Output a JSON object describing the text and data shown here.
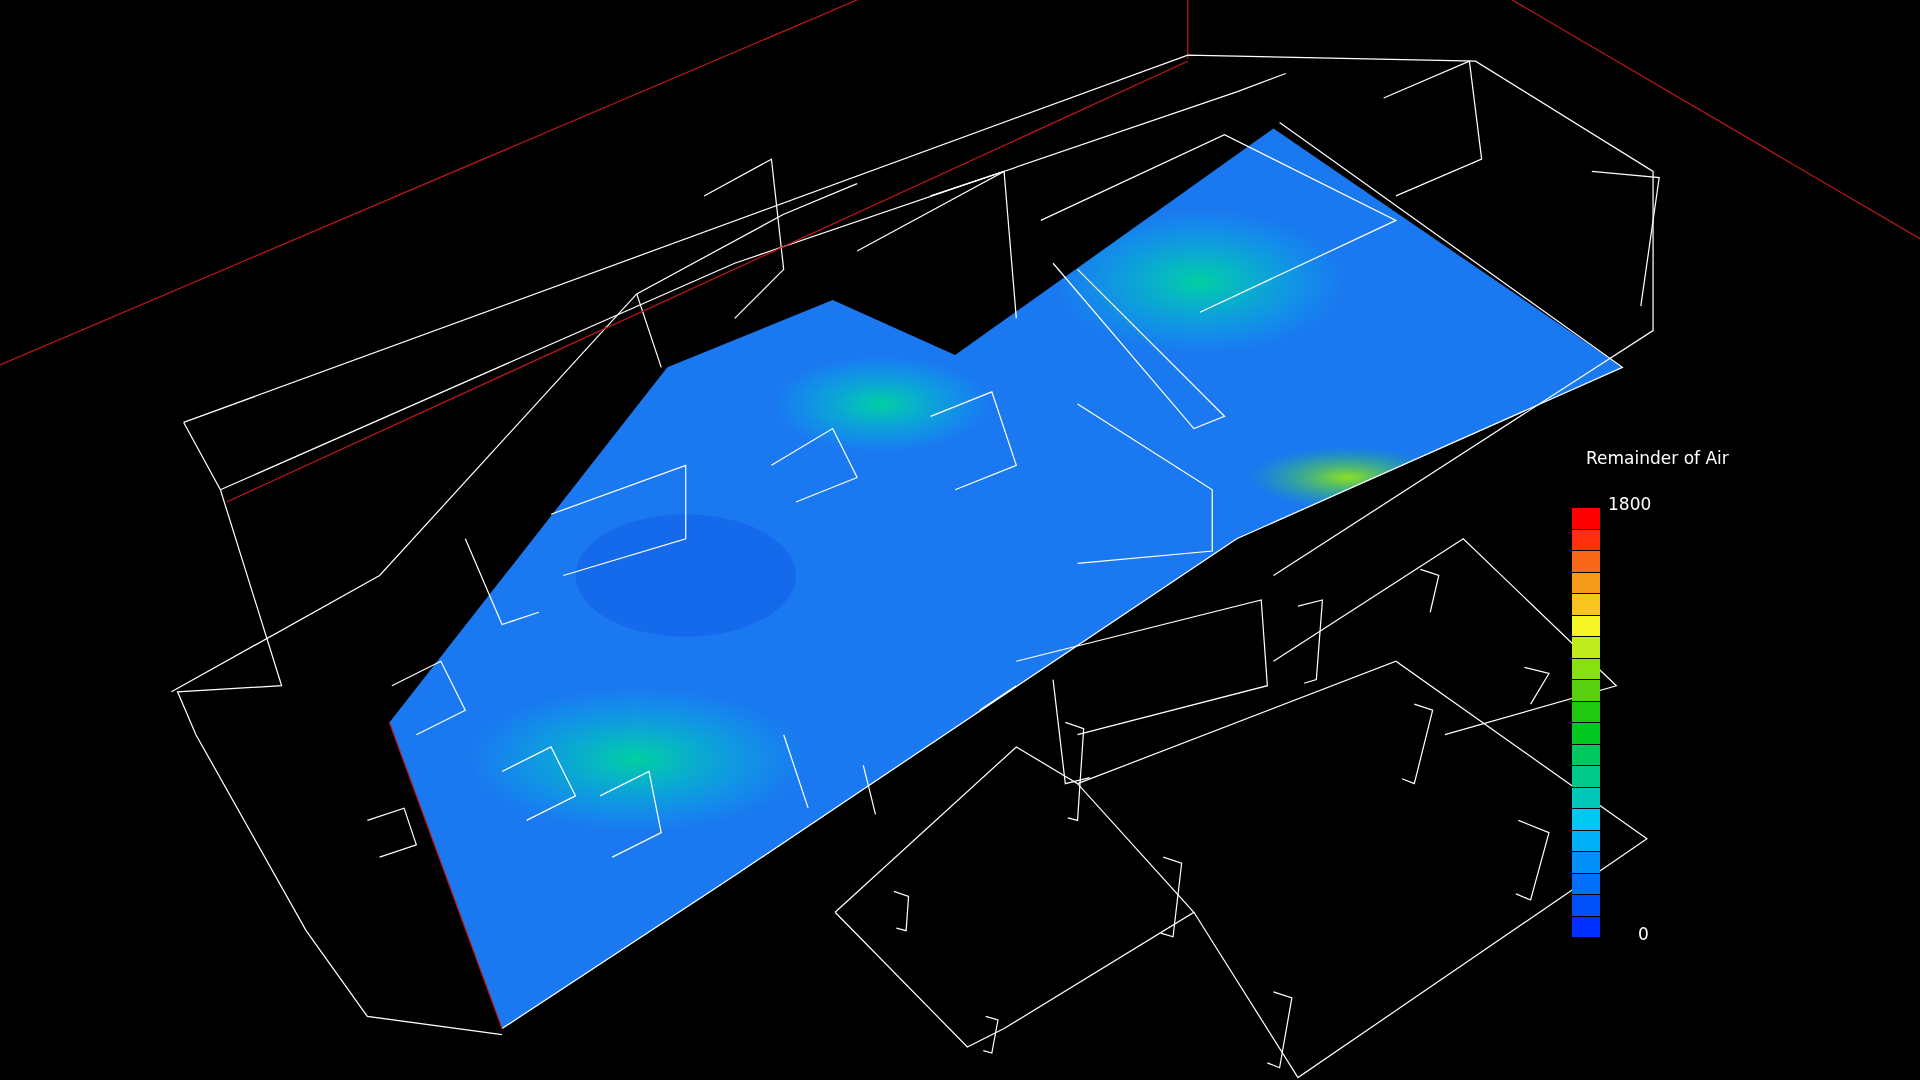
{
  "legend": {
    "title": "Remainder of Air",
    "max_label": "1800",
    "min_label": "0",
    "swatches": [
      {
        "color": "#ff0000"
      },
      {
        "color": "#ff3010"
      },
      {
        "color": "#f86818"
      },
      {
        "color": "#f59a1a"
      },
      {
        "color": "#f8c420"
      },
      {
        "color": "#f5f528"
      },
      {
        "color": "#c0ec20"
      },
      {
        "color": "#88e010"
      },
      {
        "color": "#58d010"
      },
      {
        "color": "#20c810"
      },
      {
        "color": "#00c820"
      },
      {
        "color": "#00c860"
      },
      {
        "color": "#00c888"
      },
      {
        "color": "#00c8b8"
      },
      {
        "color": "#00c8f0"
      },
      {
        "color": "#00b0f8"
      },
      {
        "color": "#0090f8"
      },
      {
        "color": "#0070f8"
      },
      {
        "color": "#0050f8"
      },
      {
        "color": "#0030ff"
      }
    ]
  }
}
